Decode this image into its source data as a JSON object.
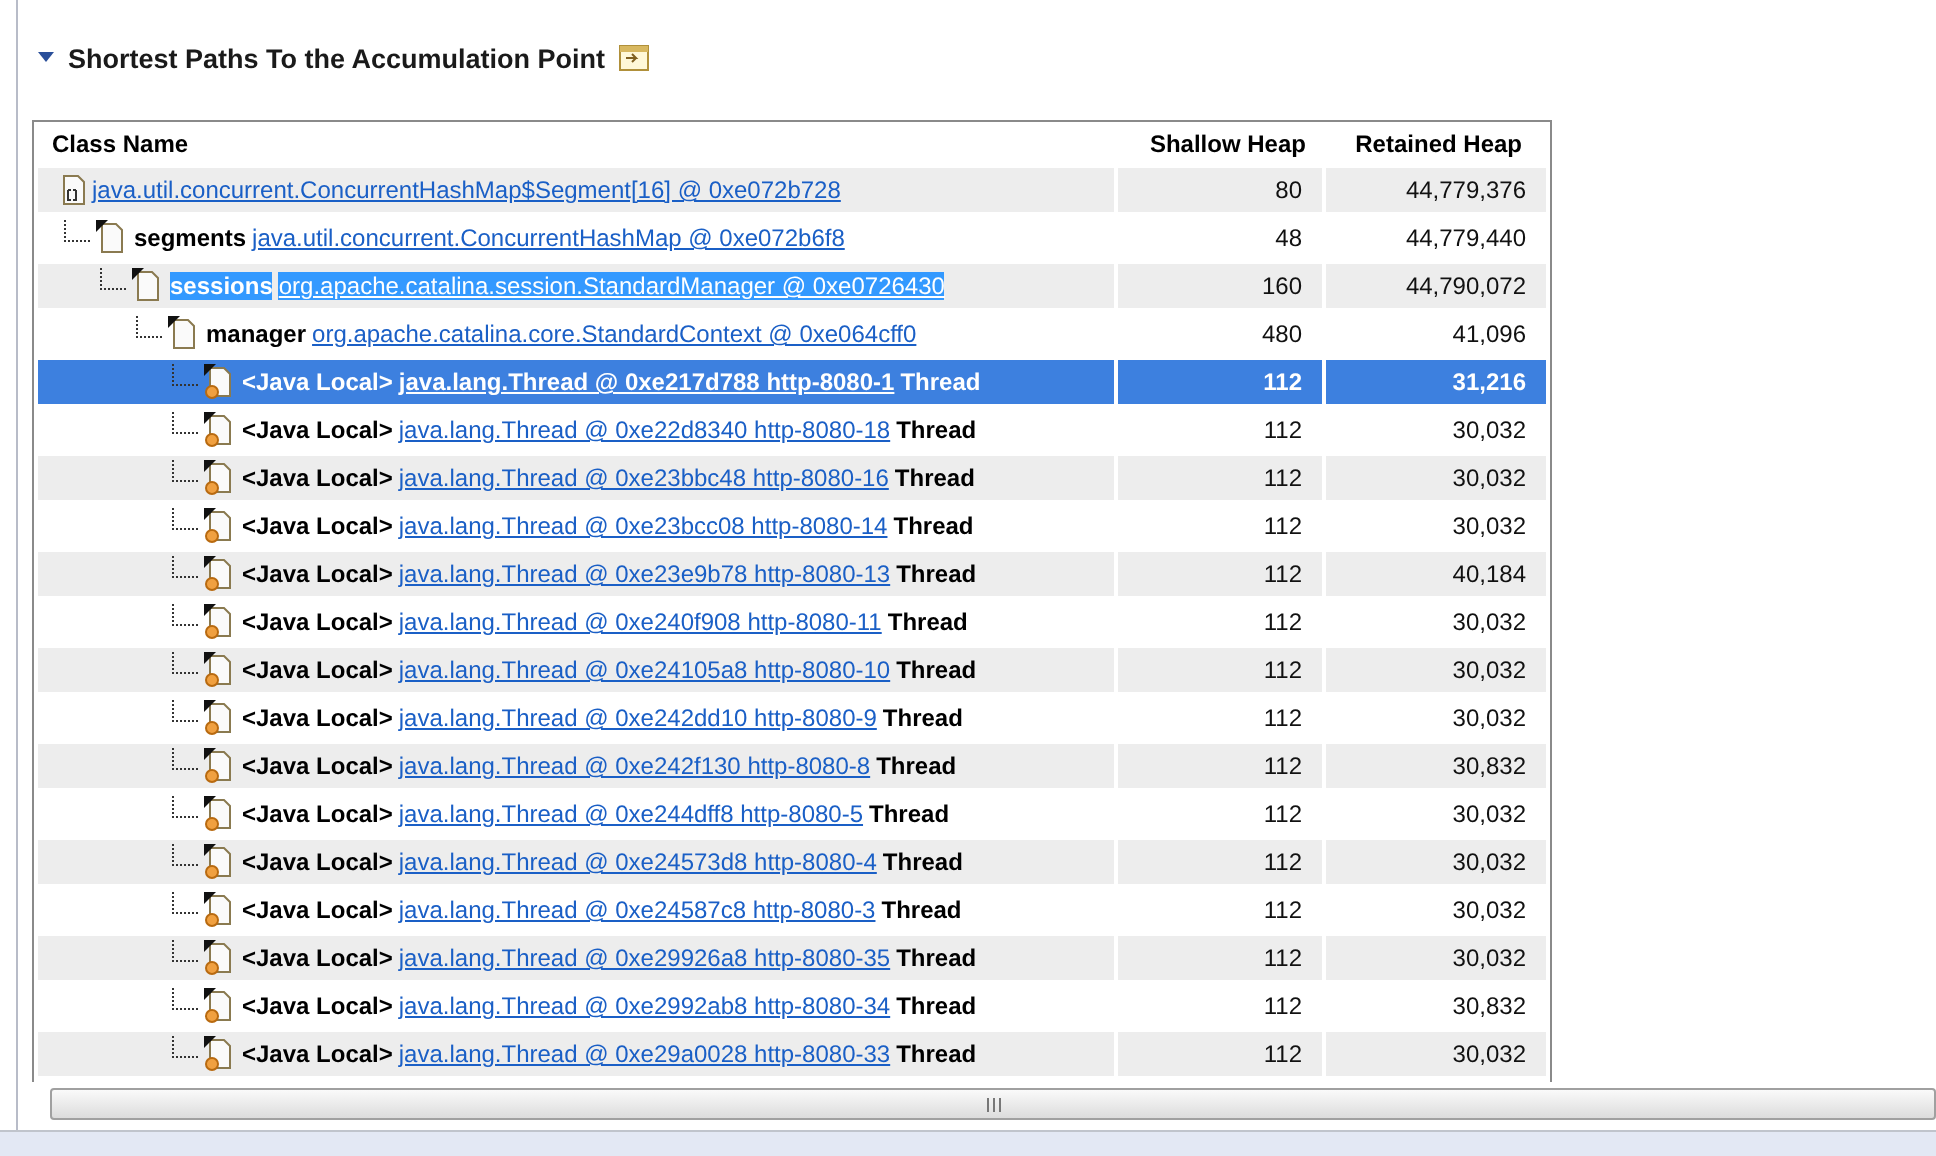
{
  "section": {
    "title": "Shortest Paths To the Accumulation Point",
    "expanded": true
  },
  "table": {
    "columns": [
      "Class Name",
      "Shallow Heap",
      "Retained Heap"
    ],
    "rows": [
      {
        "kind": "array",
        "link": "java.util.concurrent.ConcurrentHashMap$Segment[16] @ 0xe072b728",
        "shallow": "80",
        "retained": "44,779,376",
        "selected": false,
        "children": [
          {
            "kind": "object",
            "field": "segments",
            "link": "java.util.concurrent.ConcurrentHashMap @ 0xe072b6f8",
            "shallow": "48",
            "retained": "44,779,440",
            "selected": false,
            "children": [
              {
                "kind": "object",
                "field": "sessions",
                "link": "org.apache.catalina.session.StandardManager @ 0xe0726430",
                "shallow": "160",
                "retained": "44,790,072",
                "selected": false,
                "text_selected": true,
                "children": [
                  {
                    "kind": "object",
                    "field": "manager",
                    "link": "org.apache.catalina.core.StandardContext @ 0xe064cff0",
                    "shallow": "480",
                    "retained": "41,096",
                    "selected": false,
                    "children": [
                      {
                        "kind": "thread",
                        "field": "<Java Local>",
                        "link": "java.lang.Thread @ 0xe217d788 http-8080-1",
                        "suffix": "Thread",
                        "shallow": "112",
                        "retained": "31,216",
                        "selected": true
                      },
                      {
                        "kind": "thread",
                        "field": "<Java Local>",
                        "link": "java.lang.Thread @ 0xe22d8340 http-8080-18",
                        "suffix": "Thread",
                        "shallow": "112",
                        "retained": "30,032",
                        "selected": false
                      },
                      {
                        "kind": "thread",
                        "field": "<Java Local>",
                        "link": "java.lang.Thread @ 0xe23bbc48 http-8080-16",
                        "suffix": "Thread",
                        "shallow": "112",
                        "retained": "30,032",
                        "selected": false
                      },
                      {
                        "kind": "thread",
                        "field": "<Java Local>",
                        "link": "java.lang.Thread @ 0xe23bcc08 http-8080-14",
                        "suffix": "Thread",
                        "shallow": "112",
                        "retained": "30,032",
                        "selected": false
                      },
                      {
                        "kind": "thread",
                        "field": "<Java Local>",
                        "link": "java.lang.Thread @ 0xe23e9b78 http-8080-13",
                        "suffix": "Thread",
                        "shallow": "112",
                        "retained": "40,184",
                        "selected": false
                      },
                      {
                        "kind": "thread",
                        "field": "<Java Local>",
                        "link": "java.lang.Thread @ 0xe240f908 http-8080-11",
                        "suffix": "Thread",
                        "shallow": "112",
                        "retained": "30,032",
                        "selected": false
                      },
                      {
                        "kind": "thread",
                        "field": "<Java Local>",
                        "link": "java.lang.Thread @ 0xe24105a8 http-8080-10",
                        "suffix": "Thread",
                        "shallow": "112",
                        "retained": "30,032",
                        "selected": false
                      },
                      {
                        "kind": "thread",
                        "field": "<Java Local>",
                        "link": "java.lang.Thread @ 0xe242dd10 http-8080-9",
                        "suffix": "Thread",
                        "shallow": "112",
                        "retained": "30,032",
                        "selected": false
                      },
                      {
                        "kind": "thread",
                        "field": "<Java Local>",
                        "link": "java.lang.Thread @ 0xe242f130 http-8080-8",
                        "suffix": "Thread",
                        "shallow": "112",
                        "retained": "30,832",
                        "selected": false
                      },
                      {
                        "kind": "thread",
                        "field": "<Java Local>",
                        "link": "java.lang.Thread @ 0xe244dff8 http-8080-5",
                        "suffix": "Thread",
                        "shallow": "112",
                        "retained": "30,032",
                        "selected": false
                      },
                      {
                        "kind": "thread",
                        "field": "<Java Local>",
                        "link": "java.lang.Thread @ 0xe24573d8 http-8080-4",
                        "suffix": "Thread",
                        "shallow": "112",
                        "retained": "30,032",
                        "selected": false
                      },
                      {
                        "kind": "thread",
                        "field": "<Java Local>",
                        "link": "java.lang.Thread @ 0xe24587c8 http-8080-3",
                        "suffix": "Thread",
                        "shallow": "112",
                        "retained": "30,032",
                        "selected": false
                      },
                      {
                        "kind": "thread",
                        "field": "<Java Local>",
                        "link": "java.lang.Thread @ 0xe29926a8 http-8080-35",
                        "suffix": "Thread",
                        "shallow": "112",
                        "retained": "30,032",
                        "selected": false
                      },
                      {
                        "kind": "thread",
                        "field": "<Java Local>",
                        "link": "java.lang.Thread @ 0xe2992ab8 http-8080-34",
                        "suffix": "Thread",
                        "shallow": "112",
                        "retained": "30,832",
                        "selected": false
                      },
                      {
                        "kind": "thread",
                        "field": "<Java Local>",
                        "link": "java.lang.Thread @ 0xe29a0028 http-8080-33",
                        "suffix": "Thread",
                        "shallow": "112",
                        "retained": "30,032",
                        "selected": false
                      }
                    ]
                  }
                ]
              }
            ]
          }
        ]
      }
    ]
  }
}
